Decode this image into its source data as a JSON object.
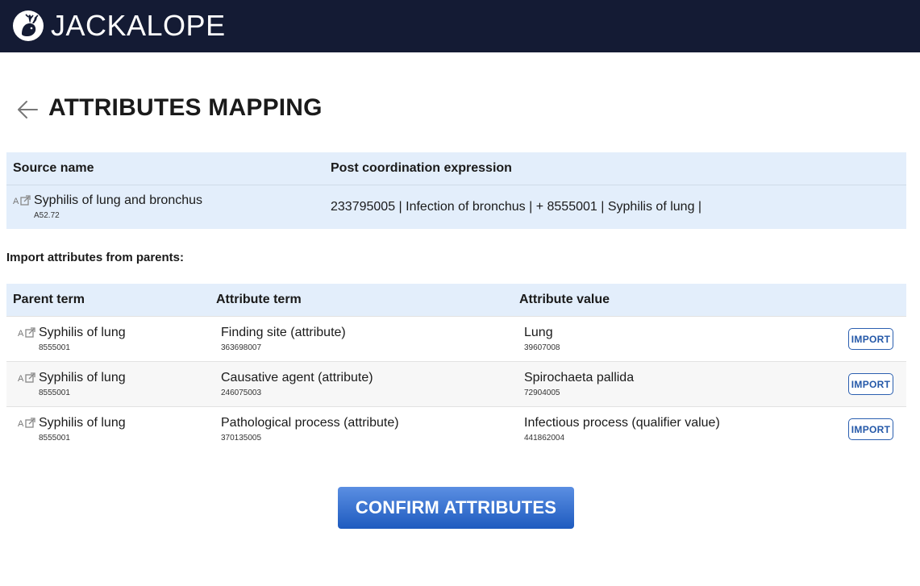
{
  "app": {
    "brand": "JACKALOPE"
  },
  "page": {
    "title": "ATTRIBUTES MAPPING"
  },
  "source_table": {
    "headers": [
      "Source name",
      "Post coordination expression"
    ],
    "row": {
      "name": "Syphilis of lung and bronchus",
      "code": "A52.72",
      "expression": "233795005 | Infection of bronchus | + 8555001 | Syphilis of lung |"
    }
  },
  "import_section": {
    "label": "Import attributes from parents:"
  },
  "attributes_table": {
    "headers": [
      "Parent term",
      "Attribute term",
      "Attribute value",
      ""
    ],
    "rows": [
      {
        "parent": "Syphilis of lung",
        "parent_code": "8555001",
        "attribute": "Finding site (attribute)",
        "attribute_code": "363698007",
        "value": "Lung",
        "value_code": "39607008",
        "action": "IMPORT"
      },
      {
        "parent": "Syphilis of lung",
        "parent_code": "8555001",
        "attribute": "Causative agent (attribute)",
        "attribute_code": "246075003",
        "value": "Spirochaeta pallida",
        "value_code": "72904005",
        "action": "IMPORT"
      },
      {
        "parent": "Syphilis of lung",
        "parent_code": "8555001",
        "attribute": "Pathological process (attribute)",
        "attribute_code": "370135005",
        "value": "Infectious process (qualifier value)",
        "value_code": "441862004",
        "action": "IMPORT"
      }
    ]
  },
  "confirm_button": {
    "label": "CONFIRM ATTRIBUTES"
  },
  "icons": {
    "logo": "jackalope-logo-icon",
    "back": "arrow-left-icon",
    "term_link": "external-link-icon"
  },
  "colors": {
    "topbar": "#141b34",
    "table_header": "#e3eefb",
    "accent": "#2458a8",
    "button_top": "#5b8fe2",
    "button_bottom": "#1e5bbf"
  }
}
